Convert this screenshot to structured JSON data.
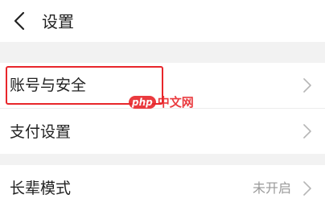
{
  "header": {
    "title": "设置",
    "back_icon": "chevron-left-icon"
  },
  "settings": {
    "items": [
      {
        "label": "账号与安全",
        "value": "",
        "icon": "chevron-right-icon"
      },
      {
        "label": "支付设置",
        "value": "",
        "icon": "chevron-right-icon"
      },
      {
        "label": "长辈模式",
        "value": "未开启",
        "icon": "chevron-right-icon"
      }
    ]
  },
  "annotation": {
    "highlight_color": "#e8262b"
  },
  "watermark": {
    "badge": "php",
    "text": "中文网",
    "color": "#e8262b"
  }
}
